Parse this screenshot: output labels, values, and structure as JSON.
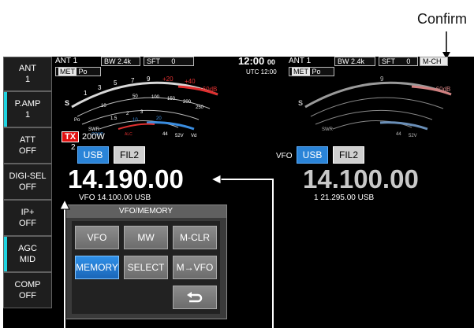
{
  "annotation": {
    "confirm_label": "Confirm"
  },
  "sidebar": [
    {
      "title": "ANT",
      "value": "1"
    },
    {
      "title": "P.AMP",
      "value": "1"
    },
    {
      "title": "ATT",
      "value": "OFF"
    },
    {
      "title": "DIGI-SEL",
      "value": "OFF"
    },
    {
      "title": "IP+",
      "value": "OFF"
    },
    {
      "title": "AGC",
      "value": "MID"
    },
    {
      "title": "COMP",
      "value": "OFF"
    }
  ],
  "main": {
    "ant": "ANT 1",
    "bw_label": "BW",
    "bw_value": "2.4k",
    "sft_label": "SFT",
    "sft_value": "0",
    "met_label": "MET",
    "met_value": "Po",
    "tx_badge": "TX",
    "power": "200W",
    "sub_number": "2",
    "mode": "USB",
    "filter": "FIL2",
    "frequency": "14.190.00",
    "sub_line": "VFO  14.100.00  USB"
  },
  "clock": {
    "time": "12:00",
    "seconds": "00",
    "utc": "UTC 12:00"
  },
  "sub": {
    "ant": "ANT 1",
    "bw_label": "BW",
    "bw_value": "2.4k",
    "sft_label": "SFT",
    "sft_value": "0",
    "mch": "M-CH",
    "met_label": "MET",
    "met_value": "Po",
    "vfo_label": "VFO",
    "mode": "USB",
    "filter": "FIL2",
    "frequency": "14.100.00",
    "sub_line": "1  21.295.00  USB"
  },
  "meter": {
    "s_label": "S",
    "po_label": "Po",
    "swr_label": "SWR",
    "comp_label": "COMP",
    "alc_label": "ALC",
    "v44": "44",
    "v52": "52V",
    "vd": "Vd",
    "s_ticks": [
      "1",
      "3",
      "5",
      "7",
      "9",
      "+20",
      "+40",
      "+60dB"
    ],
    "po_ticks": [
      "0",
      "10",
      "50",
      "100",
      "150",
      "200",
      "250",
      "W"
    ],
    "swr_ticks": [
      "1",
      "1.5",
      "2",
      "3",
      "∞"
    ],
    "comp_ticks": [
      "10",
      "20"
    ],
    "db_label": "dB"
  },
  "popup": {
    "title": "VFO/MEMORY",
    "buttons": [
      "VFO",
      "MW",
      "M-CLR",
      "MEMORY",
      "SELECT",
      "M→VFO"
    ],
    "return_icon": "return-arrow-icon"
  },
  "colors": {
    "accent_blue": "#2a84d8",
    "cyan": "#1fd3e0",
    "tx_red": "#e01010",
    "meter_red": "#e03030"
  }
}
